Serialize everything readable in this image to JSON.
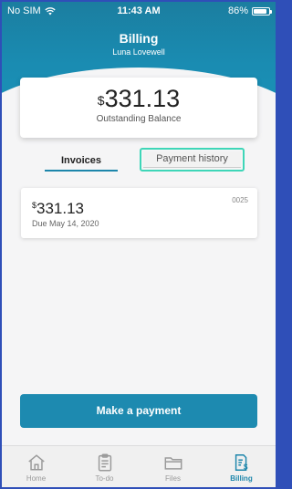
{
  "status_bar": {
    "carrier": "No SIM",
    "time": "11:43 AM",
    "battery": "86%",
    "battery_level": 0.86
  },
  "header": {
    "title": "Billing",
    "subtitle": "Luna Lovewell"
  },
  "balance": {
    "currency": "$",
    "amount": "331.13",
    "label": "Outstanding Balance"
  },
  "tabs": {
    "invoices": "Invoices",
    "payment_history": "Payment history",
    "active": "invoices"
  },
  "invoices": [
    {
      "currency": "$",
      "amount": "331.13",
      "due": "Due May 14, 2020",
      "number": "0025"
    }
  ],
  "actions": {
    "make_payment": "Make a payment"
  },
  "tabbar": {
    "items": [
      {
        "label": "Home",
        "icon": "home-icon"
      },
      {
        "label": "To-do",
        "icon": "clipboard-icon"
      },
      {
        "label": "Files",
        "icon": "folder-icon"
      },
      {
        "label": "Billing",
        "icon": "billing-icon",
        "active": true
      }
    ]
  },
  "colors": {
    "accent": "#1d86ab",
    "highlight": "#3ed6b8"
  }
}
